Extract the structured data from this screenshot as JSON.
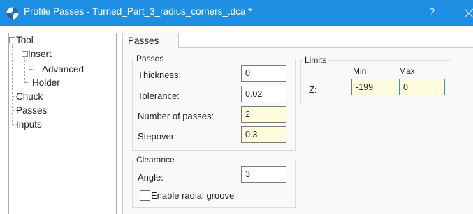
{
  "window": {
    "title": "Profile Passes - Turned_Part_3_radius_corners_.dca *",
    "help_label": "?",
    "title_bar_color": "#1e8ee2"
  },
  "tree": {
    "items": [
      {
        "label": "Tool",
        "expanded": true
      },
      {
        "label": "Insert",
        "expanded": true
      },
      {
        "label": "Advanced"
      },
      {
        "label": "Holder"
      },
      {
        "label": "Chuck"
      },
      {
        "label": "Passes"
      },
      {
        "label": "Inputs"
      }
    ]
  },
  "tabs": [
    {
      "label": "Passes",
      "active": true
    }
  ],
  "passes_group": {
    "title": "Passes",
    "fields": [
      {
        "label": "Thickness:",
        "value": "0",
        "style": "white"
      },
      {
        "label": "Tolerance:",
        "value": "0.02",
        "style": "white"
      },
      {
        "label": "Number of passes:",
        "value": "2",
        "style": "yellow"
      },
      {
        "label": "Stepover:",
        "value": "0.3",
        "style": "yellow"
      }
    ]
  },
  "clearance_group": {
    "title": "Clearance",
    "angle_label": "Angle:",
    "angle_value": "3",
    "checkbox_label": "Enable radial groove",
    "checkbox_checked": false
  },
  "limits_group": {
    "title": "Limits",
    "col_min": "Min",
    "col_max": "Max",
    "row_label": "Z:",
    "min_value": "-199",
    "max_value": "0"
  },
  "colors": {
    "input_highlight": "#fffbdd",
    "focus_border": "#3a8fd6"
  }
}
